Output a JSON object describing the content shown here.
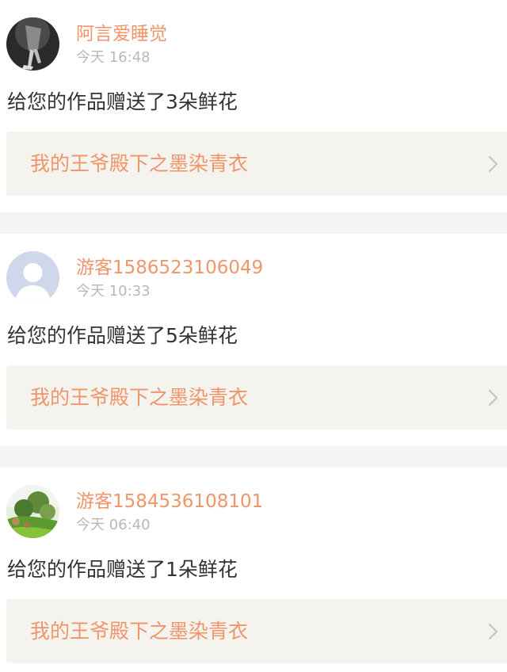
{
  "notifications": [
    {
      "username": "阿言爱睡觉",
      "time": "今天 16:48",
      "message": "给您的作品赠送了3朵鲜花",
      "work_title": "我的王爷殿下之墨染青衣",
      "avatar_icon": "photo-avatar-icon"
    },
    {
      "username": "游客1586523106049",
      "time": "今天 10:33",
      "message": "给您的作品赠送了5朵鲜花",
      "work_title": "我的王爷殿下之墨染青衣",
      "avatar_icon": "default-user-avatar-icon"
    },
    {
      "username": "游客1584536108101",
      "time": "今天 06:40",
      "message": "给您的作品赠送了1朵鲜花",
      "work_title": "我的王爷殿下之墨染青衣",
      "avatar_icon": "landscape-avatar-icon"
    }
  ],
  "colors": {
    "accent": "#f0956a",
    "timestamp": "#b8b8b8",
    "text": "#333333",
    "link_background": "#f4f3ee",
    "page_background": "#f4f4f4"
  }
}
